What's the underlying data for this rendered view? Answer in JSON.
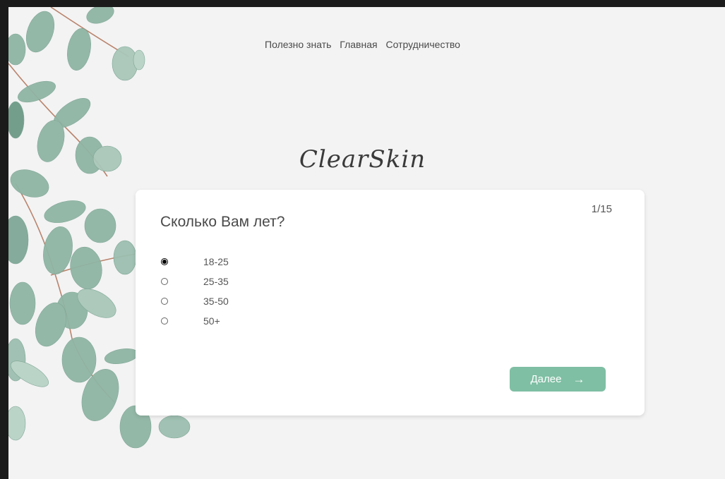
{
  "nav": {
    "items": [
      "Полезно знать",
      "Главная",
      "Сотрудничество"
    ]
  },
  "logo": {
    "text": "ClearSkin"
  },
  "quiz": {
    "progress": "1/15",
    "question": "Сколько Вам лет?",
    "options": [
      {
        "label": "18-25",
        "checked": true
      },
      {
        "label": "25-35",
        "checked": false
      },
      {
        "label": "35-50",
        "checked": false
      },
      {
        "label": "50+",
        "checked": false
      }
    ],
    "next_label": "Далее",
    "next_icon": "arrow-right-icon"
  },
  "colors": {
    "background": "#f3f3f3",
    "card": "#ffffff",
    "accent": "#7fbfa4",
    "leaf": "#8fb5a4"
  }
}
